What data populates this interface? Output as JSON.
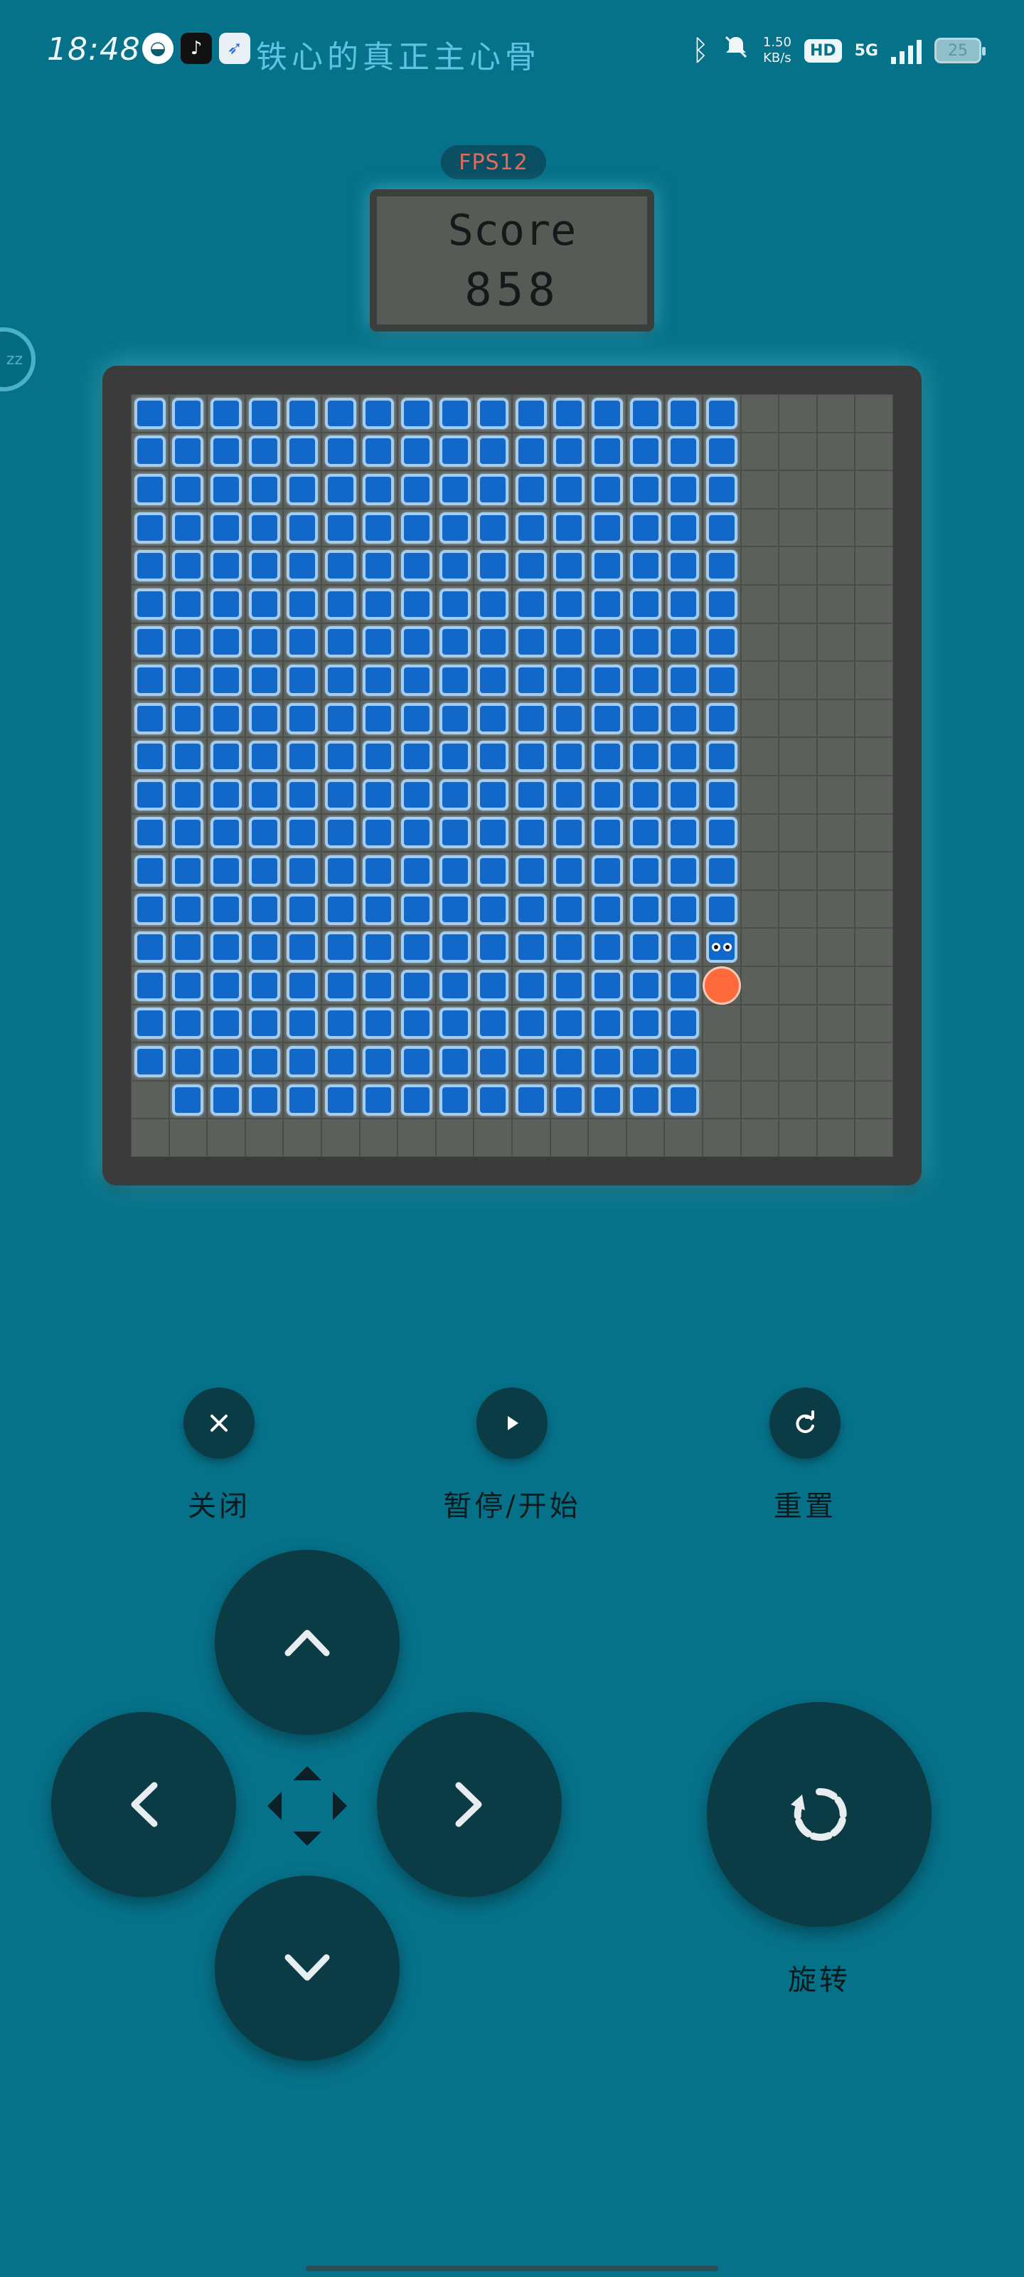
{
  "status_bar": {
    "time": "18:48",
    "lyric": "铁心的真正主心骨",
    "net_speed_value": "1.50",
    "net_speed_unit": "KB/s",
    "hd_badge": "HD",
    "network": "5G",
    "battery": "25"
  },
  "hud": {
    "fps": "FPS12",
    "score_label": "Score",
    "score_value": "858"
  },
  "board": {
    "cols": 20,
    "rows": 20,
    "filled_rows_full": [
      0,
      1,
      2,
      3,
      4,
      5,
      6,
      7,
      8,
      9,
      10,
      11,
      12,
      13
    ],
    "row_14_cols": 15,
    "row_15_cols": 15,
    "row_16_cols": 15,
    "row_17_cols": 15,
    "row_18_start": 1,
    "row_18_end": 14,
    "piece_eyes": {
      "row": 14,
      "col": 15
    },
    "ball": {
      "row": 15,
      "col": 15
    }
  },
  "controls": {
    "close_label": "关闭",
    "pause_label": "暂停/开始",
    "reset_label": "重置",
    "rotate_label": "旋转"
  },
  "colors": {
    "background": "#06728a",
    "block": "#1168c9",
    "block_border": "#a6cdf0",
    "button": "#0b3b45",
    "ball": "#ff6a3d"
  }
}
